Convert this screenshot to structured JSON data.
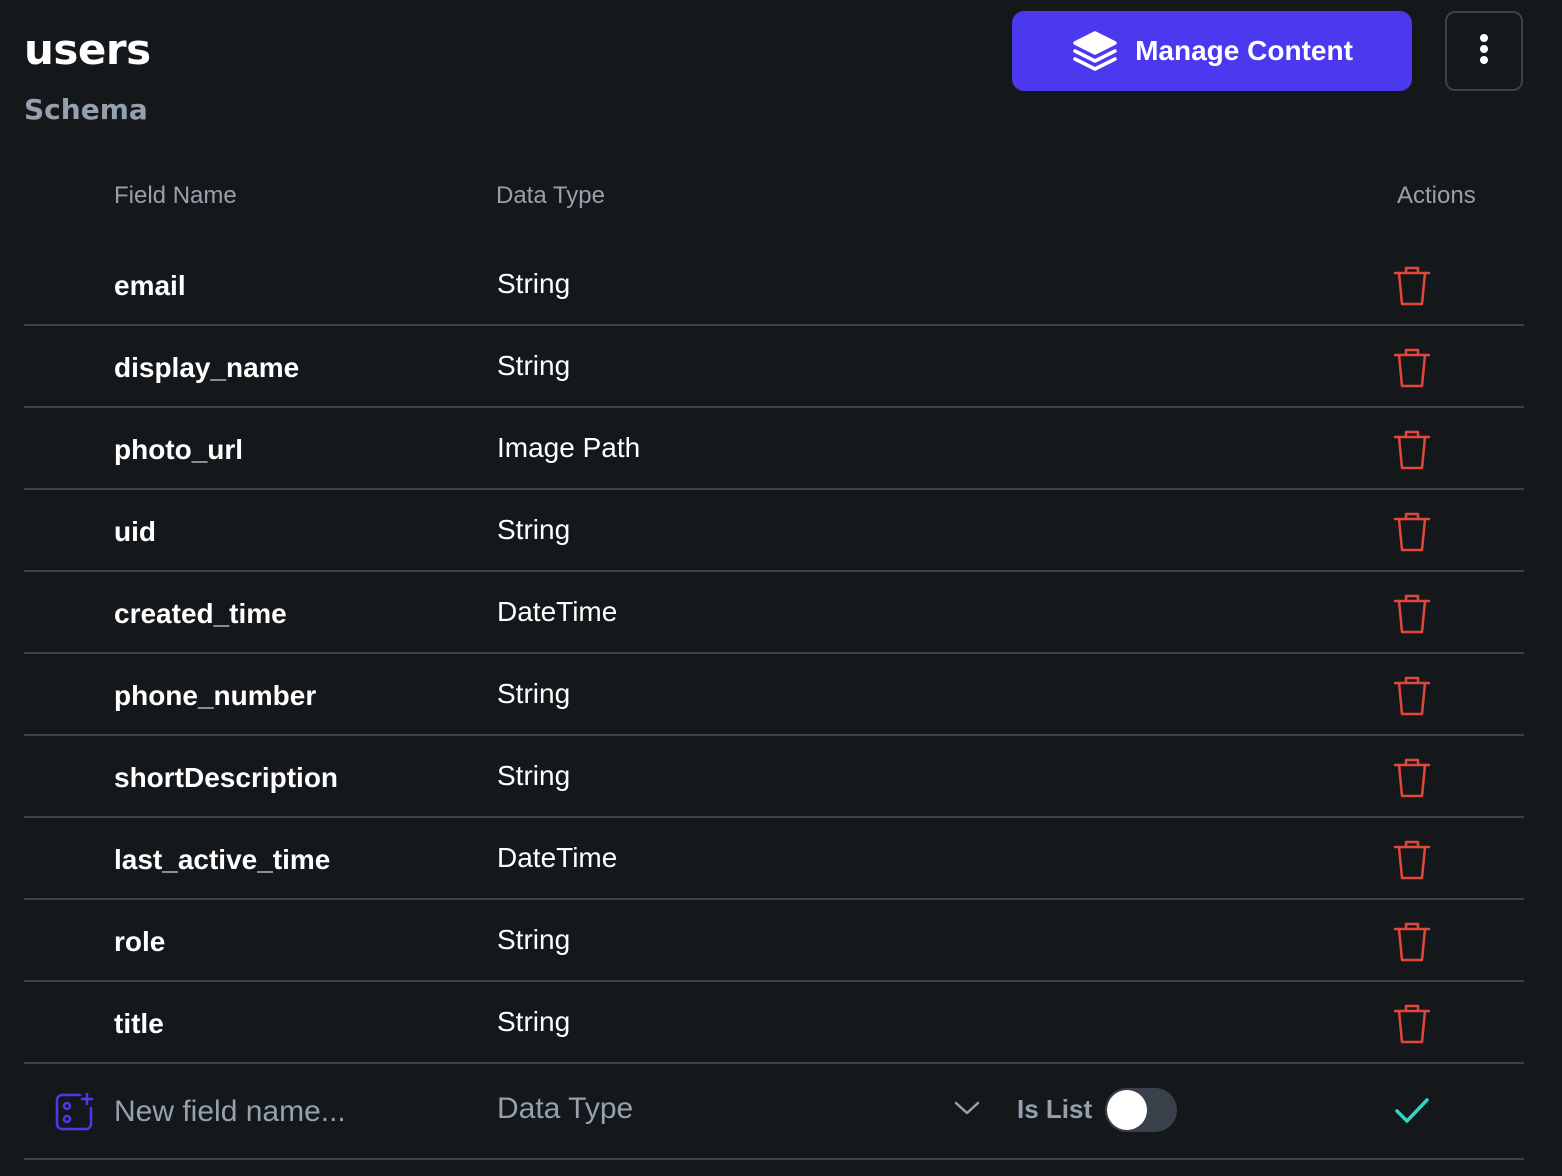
{
  "header": {
    "title": "users",
    "subtitle": "Schema",
    "manage_button": {
      "label": "Manage Content",
      "icon": "layers-icon",
      "color": "#4b39ef"
    },
    "more_button": {
      "icon": "more-vertical-icon"
    }
  },
  "columns": {
    "field_name": "Field Name",
    "data_type": "Data Type",
    "actions": "Actions"
  },
  "fields": [
    {
      "name": "email",
      "type": "String"
    },
    {
      "name": "display_name",
      "type": "String"
    },
    {
      "name": "photo_url",
      "type": "Image Path"
    },
    {
      "name": "uid",
      "type": "String"
    },
    {
      "name": "created_time",
      "type": "DateTime"
    },
    {
      "name": "phone_number",
      "type": "String"
    },
    {
      "name": "shortDescription",
      "type": "String"
    },
    {
      "name": "last_active_time",
      "type": "DateTime"
    },
    {
      "name": "role",
      "type": "String"
    },
    {
      "name": "title",
      "type": "String"
    }
  ],
  "new_field": {
    "name_value": "",
    "name_placeholder": "New field name...",
    "type_placeholder": "Data Type",
    "is_list_label": "Is List",
    "is_list_on": false
  },
  "colors": {
    "background": "#14181b",
    "delete": "#e0483c",
    "confirm": "#39d2c0",
    "secondary_text": "#95a1ac",
    "divider": "#39424a"
  }
}
